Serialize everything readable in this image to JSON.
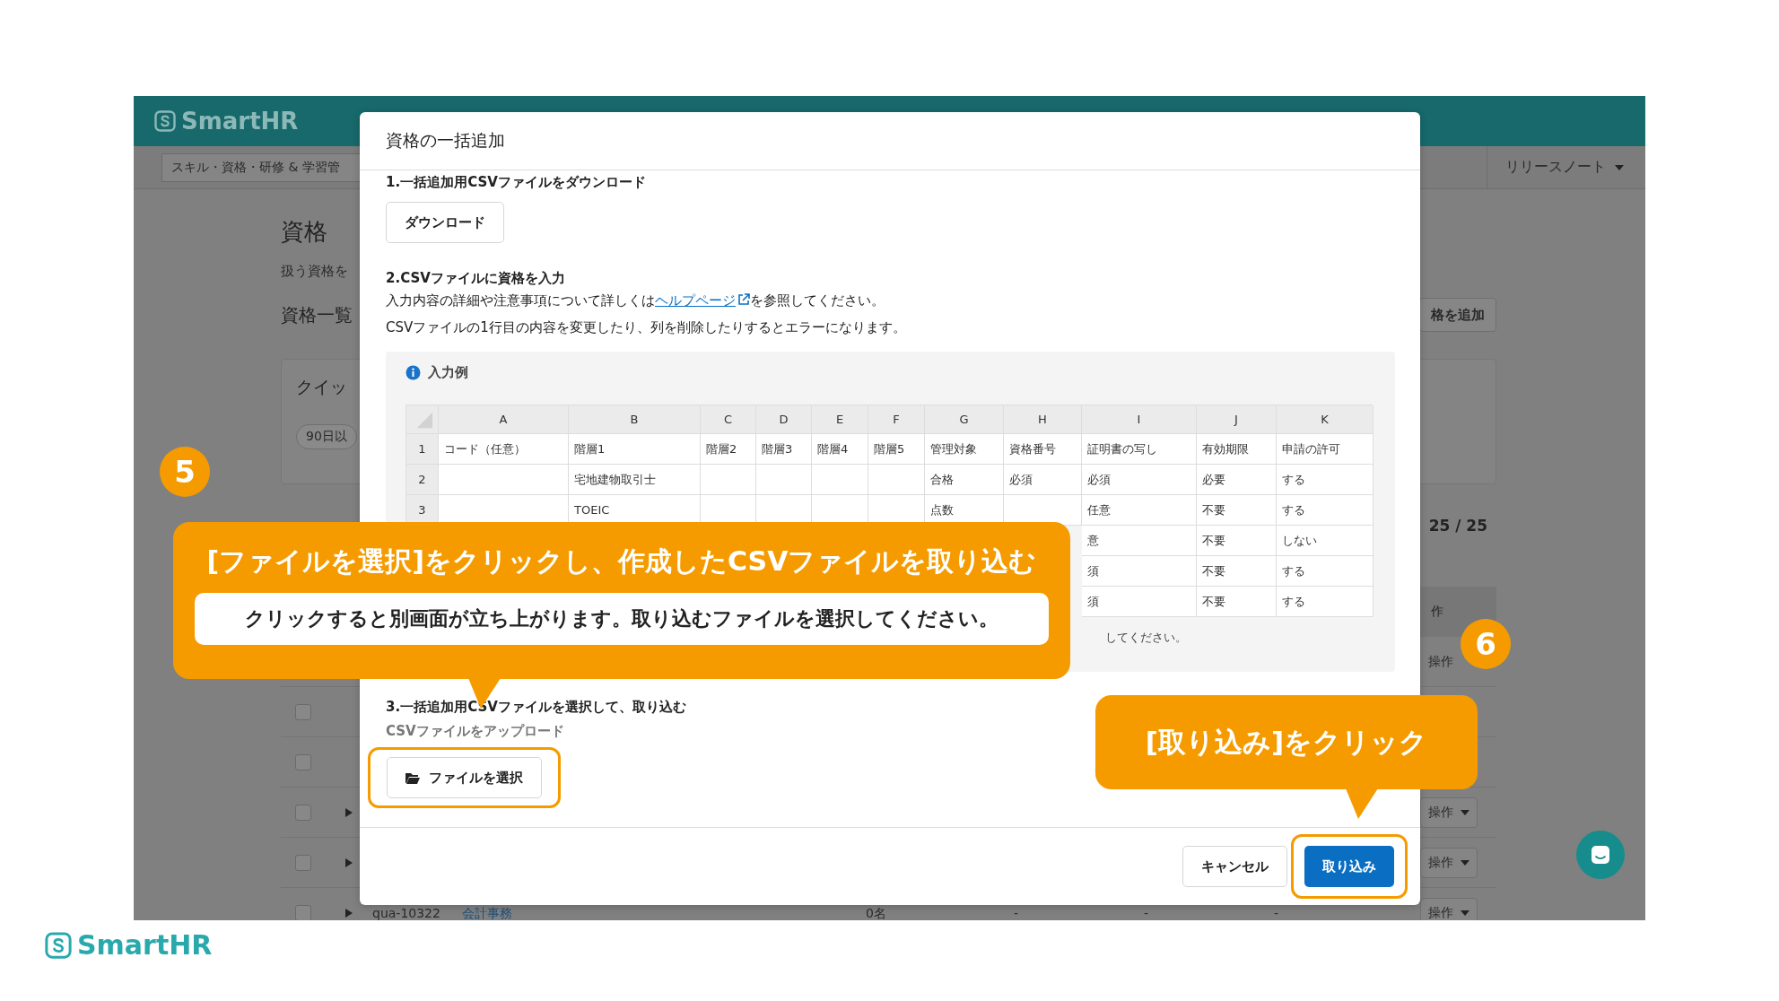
{
  "app": {
    "logo": "SmartHR",
    "nav_tab": "スキル・資格・研修 & 学習管",
    "release_notes": "リリースノート",
    "page_title": "資格",
    "description": "扱う資格を",
    "list_heading": "資格一覧",
    "add_button": "格を追加",
    "quick_filter": {
      "label": "クイッ",
      "chip": "90日以"
    },
    "pagination": "25 / 25",
    "column_heading": "作",
    "rows": [
      {
        "action": "操作",
        "has_menu": false
      },
      {
        "checkbox": true,
        "checked": false,
        "expandable": false
      },
      {
        "checkbox": true,
        "checked": false,
        "expandable": false
      },
      {
        "checkbox": true,
        "checked": false,
        "expandable": true,
        "action": "操作",
        "has_menu": true
      },
      {
        "checkbox": true,
        "checked": false,
        "expandable": true,
        "action": "操作",
        "has_menu": true
      },
      {
        "checkbox": true,
        "checked": false,
        "expandable": true,
        "code": "qua-10322",
        "name": "会計事務",
        "count": "0名",
        "dashes": [
          "-",
          "-",
          "-"
        ],
        "action": "操作",
        "has_menu": true
      }
    ]
  },
  "modal": {
    "title": "資格の一括追加",
    "step1": {
      "heading": "1.一括追加用CSVファイルをダウンロード",
      "button": "ダウンロード"
    },
    "step2": {
      "heading": "2.CSVファイルに資格を入力",
      "line1_before": "入力内容の詳細や注意事項について詳しくは",
      "link": "ヘルプページ",
      "line1_after": "を参照してください。",
      "line2": "CSVファイルの1行目の内容を変更したり、列を削除したりするとエラーになります。"
    },
    "example": {
      "title": "入力例",
      "columns": [
        "A",
        "B",
        "C",
        "D",
        "E",
        "F",
        "G",
        "H",
        "I",
        "J",
        "K"
      ],
      "rows": [
        {
          "number": "1",
          "cells": [
            "コード（任意）",
            "階層1",
            "階層2",
            "階層3",
            "階層4",
            "階層5",
            "管理対象",
            "資格番号",
            "証明書の写し",
            "有効期限",
            "申請の許可"
          ]
        },
        {
          "number": "2",
          "cells": [
            null,
            "宅地建物取引士",
            null,
            null,
            null,
            null,
            "合格",
            "必須",
            "必須",
            "必要",
            "する"
          ]
        },
        {
          "number": "3",
          "cells": [
            null,
            "TOEIC",
            null,
            null,
            null,
            null,
            "点数",
            null,
            "任意",
            "不要",
            "する"
          ]
        },
        {
          "number": null,
          "cells": [
            null,
            null,
            null,
            null,
            null,
            null,
            null,
            null,
            "意",
            "不要",
            "しない"
          ]
        },
        {
          "number": null,
          "cells": [
            null,
            null,
            null,
            null,
            null,
            null,
            null,
            null,
            "須",
            "不要",
            "する"
          ]
        },
        {
          "number": null,
          "cells": [
            null,
            null,
            null,
            null,
            null,
            null,
            null,
            null,
            "須",
            "不要",
            "する"
          ]
        }
      ],
      "note": "してください。"
    },
    "step3": {
      "heading": "3.一括追加用CSVファイルを選択して、取り込む",
      "label": "CSVファイルをアップロード",
      "button": "ファイルを選択",
      "highlighted": true
    },
    "footer": {
      "cancel": "キャンセル",
      "submit": "取り込み",
      "submit_highlighted": true
    }
  },
  "annotations": [
    {
      "kind": "callout",
      "badge": "5",
      "title": "[ファイルを選択]をクリックし、作成したCSVファイルを取り込む",
      "detail": "クリックすると別画面が立ち上がります。取り込むファイルを選択してください。"
    },
    {
      "kind": "callout",
      "badge": "6",
      "title": "[取り込み]をクリック"
    }
  ],
  "slide_logo": "SmartHR"
}
